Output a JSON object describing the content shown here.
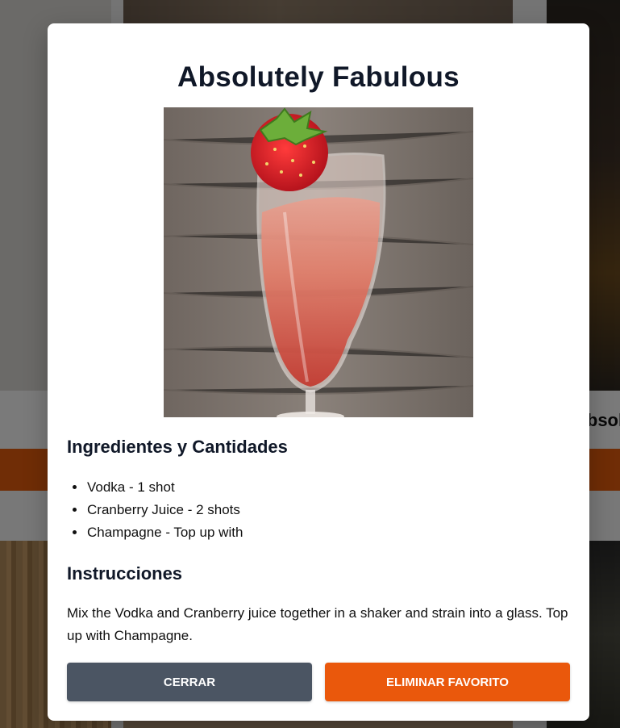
{
  "background": {
    "partial_card_title": "Absolu"
  },
  "modal": {
    "title": "Absolutely Fabulous",
    "image_alt": "Absolutely Fabulous",
    "ingredients_heading": "Ingredientes y Cantidades",
    "ingredients": [
      "Vodka - 1 shot",
      "Cranberry Juice - 2 shots",
      "Champagne - Top up with"
    ],
    "instructions_heading": "Instrucciones",
    "instructions": "Mix the Vodka and Cranberry juice together in a shaker and strain into a glass. Top up with Champagne.",
    "close_label": "Cerrar",
    "remove_favorite_label": "Eliminar Favorito"
  },
  "colors": {
    "close_button": "#4b5563",
    "remove_button": "#ea580c",
    "heading_text": "#101828"
  }
}
